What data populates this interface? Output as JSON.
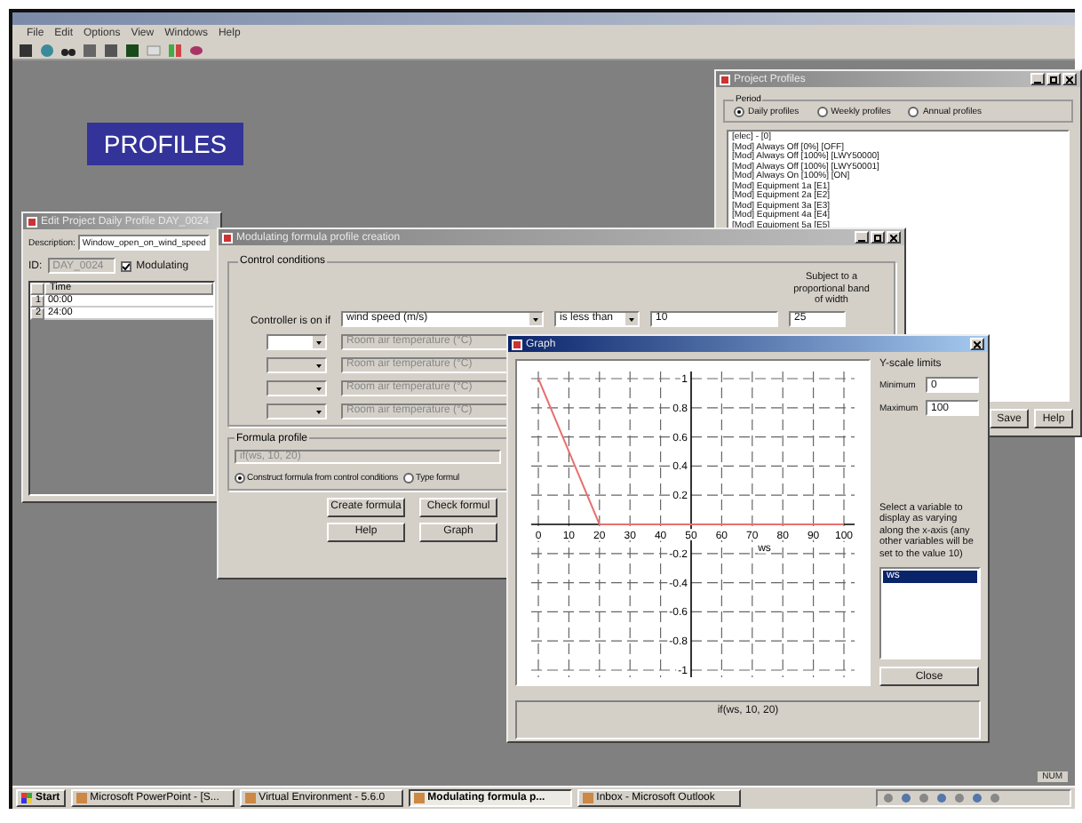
{
  "app": {
    "menu": [
      "File",
      "Edit",
      "Options",
      "View",
      "Windows",
      "Help"
    ]
  },
  "banner": {
    "text": "PROFILES"
  },
  "project_profiles": {
    "title": "Project Profiles",
    "period_label": "Period",
    "periods": [
      {
        "label": "Daily profiles",
        "selected": true
      },
      {
        "label": "Weekly profiles",
        "selected": false
      },
      {
        "label": "Annual profiles",
        "selected": false
      }
    ],
    "items": [
      "[elec] - [0]",
      "[Mod] Always Off [0%] [OFF]",
      "[Mod] Always Off [100%] [LWY50000]",
      "[Mod] Always Off [100%] [LWY50001]",
      "[Mod] Always On [100%] [ON]",
      "[Mod] Equipment 1a [E1]",
      "[Mod] Equipment 2a [E2]",
      "[Mod] Equipment 3a [E3]",
      "[Mod] Equipment 4a [E4]",
      "[Mod] Equipment 5a [E5]"
    ],
    "buttons": [
      "Save",
      "Help"
    ]
  },
  "edit_profile": {
    "title": "Edit Project Daily Profile DAY_0024",
    "description_label": "Description:",
    "description": "Window_open_on_wind_speed",
    "id_label": "ID:",
    "id": "DAY_0024",
    "modulating_label": "Modulating",
    "modulating_checked": true,
    "columns": [
      "Time"
    ],
    "rows": [
      {
        "index": "1",
        "time": "00:00"
      },
      {
        "index": "2",
        "time": "24:00"
      }
    ]
  },
  "modulating": {
    "title": "Modulating formula profile creation",
    "group": "Control conditions",
    "controller_label": "Controller is on if",
    "variable": "wind speed (m/s)",
    "operator": "is less than",
    "threshold": "10",
    "band_label": "Subject to a proportional band of width",
    "band": "25",
    "extra_conditions": [
      {
        "variable": "Room air temperature (°C)",
        "disabled": false
      },
      {
        "variable": "Room air temperature (°C)",
        "disabled": true
      },
      {
        "variable": "Room air temperature (°C)",
        "disabled": true
      },
      {
        "variable": "Room air temperature (°C)",
        "disabled": true
      }
    ],
    "formula_group": "Formula profile",
    "formula": "if(ws, 10, 20)",
    "modes": [
      {
        "label": "Construct formula from control conditions",
        "selected": true
      },
      {
        "label": "Type formul",
        "selected": false
      }
    ],
    "buttons": [
      "Create formula",
      "Check formul",
      "Help",
      "Graph"
    ]
  },
  "graph": {
    "title": "Graph",
    "chart_data": {
      "type": "line",
      "grid": true,
      "xlabel": "ws",
      "x": [
        0,
        20,
        100
      ],
      "series": [
        {
          "color": "#e87070",
          "values": [
            1,
            0,
            0
          ]
        }
      ],
      "xlim": [
        0,
        100
      ],
      "ylim": [
        -1,
        1
      ],
      "xticks": [
        0,
        10,
        20,
        30,
        40,
        50,
        60,
        70,
        80,
        90,
        100
      ],
      "yticks": [
        -1,
        -0.8,
        -0.6,
        -0.4,
        -0.2,
        0.2,
        0.4,
        0.6,
        0.8,
        1
      ]
    },
    "y_scale_label": "Y-scale limits",
    "minimum_label": "Minimum",
    "minimum": "0",
    "maximum_label": "Maximum",
    "maximum": "100",
    "hint": "Select a variable to display as varying along the x-axis (any other variables will be set to the value 10)",
    "variables": [
      {
        "label": "ws",
        "selected": true
      }
    ],
    "close": "Close",
    "formula": "if(ws, 10, 20)"
  },
  "status": {
    "num": "NUM"
  },
  "taskbar": {
    "start": "Start",
    "tasks": [
      {
        "label": "Microsoft PowerPoint - [S...",
        "selected": false
      },
      {
        "label": "Virtual Environment - 5.6.0",
        "selected": false
      },
      {
        "label": "Modulating formula p...",
        "selected": true
      },
      {
        "label": "Inbox - Microsoft Outlook",
        "selected": false
      }
    ]
  }
}
